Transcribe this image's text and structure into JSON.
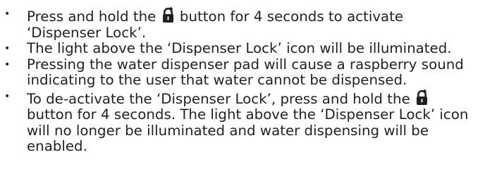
{
  "instructions": {
    "bullet_symbol": "•",
    "items": [
      {
        "before_icon": "Press and hold the ",
        "icon": "lock-icon",
        "after_icon": " button for 4 seconds to activate ‘Dispenser Lock’."
      },
      {
        "text": "The light above the ‘Dispenser Lock’ icon will be illuminated."
      },
      {
        "text": "Pressing the water dispenser pad will cause a raspberry sound indicating to the user that water cannot be dispensed."
      },
      {
        "before_icon": "To de-activate the ‘Dispenser Lock’, press and hold the ",
        "icon": "lock-icon",
        "after_icon": " button for 4 seconds. The light above the ‘Dispenser Lock’ icon will no longer be illuminated and water dispensing will be enabled."
      }
    ]
  }
}
